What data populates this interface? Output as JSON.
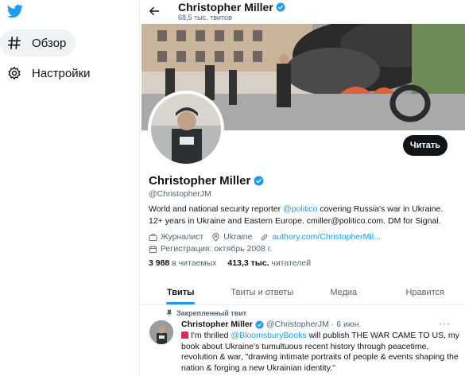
{
  "nav": {
    "items": [
      {
        "label": "Обзор",
        "icon": "hashtag-icon",
        "active": true
      },
      {
        "label": "Настройки",
        "icon": "gear-icon",
        "active": false
      }
    ]
  },
  "topbar": {
    "name": "Christopher Miller",
    "tweet_count": "68,5 тыс. твитов"
  },
  "profile": {
    "follow_label": "Читать",
    "name": "Christopher Miller",
    "handle": "@ChristopherJM",
    "bio_before": "World and national security reporter ",
    "bio_link": "@politico",
    "bio_after": " covering Russia's war in Ukraine. 12+ years in Ukraine and Eastern Europe. cmiller@politico.com. DM for Signal.",
    "profession": "Журналист",
    "location": "Ukraine",
    "website": "authory.com/ChristopherMil...",
    "joined": "Регистрация: октябрь 2008 г.",
    "following_count": "3 988",
    "following_label": "в читаемых",
    "followers_count": "413,3 тыс.",
    "followers_label": "читателей"
  },
  "tabs": [
    {
      "label": "Твиты",
      "active": true
    },
    {
      "label": "Твиты и ответы",
      "active": false
    },
    {
      "label": "Медиа",
      "active": false
    },
    {
      "label": "Нравится",
      "active": false
    }
  ],
  "tweet": {
    "pinned_label": "Закрепленный твит",
    "name": "Christopher Miller",
    "handle": "@ChristopherJM",
    "separator": "·",
    "date": "6 июн.",
    "more": "···",
    "text_before": "I'm thrilled ",
    "text_link": "@BloomsburyBooks",
    "text_after": " will publish THE WAR CAME TO US, my book about Ukraine's tumultuous recent history through peacetime, revolution & war, \"drawing intimate portraits of people & events shaping the nation & forging a new Ukrainian identity.\""
  },
  "colors": {
    "accent": "#1d9bf0",
    "text": "#0f1419",
    "muted": "#536471",
    "follow_button": "#0f1419"
  }
}
